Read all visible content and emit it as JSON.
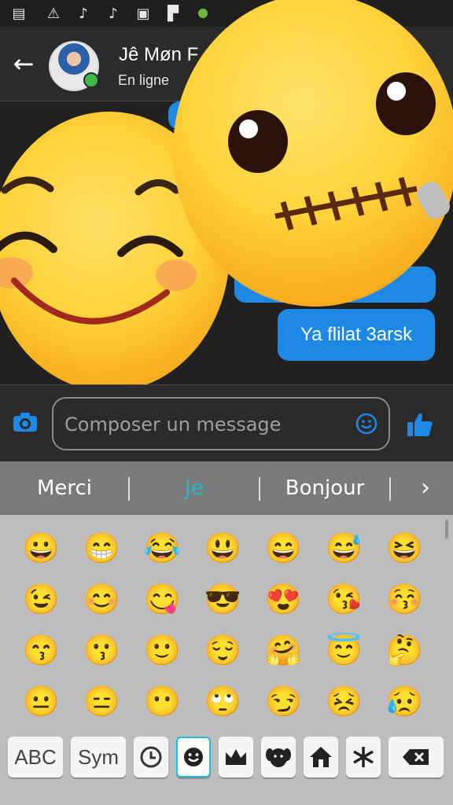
{
  "status_bar": {
    "icons": [
      "message-icon",
      "warning-icon",
      "tiktok-icon",
      "tiktok-icon",
      "image-icon",
      "flipboard-icon"
    ]
  },
  "header": {
    "back_icon": "back-arrow-icon",
    "contact_name": "Jê Møn F",
    "status": "En ligne"
  },
  "chat": {
    "messages": [
      {
        "text": "Ya flilat 3arsk",
        "from": "me"
      }
    ],
    "overlays": [
      "smiling-face-emoji",
      "zipper-mouth-face-emoji"
    ]
  },
  "composer": {
    "placeholder": "Composer un message",
    "camera_icon": "camera-icon",
    "emoji_icon": "smiley-icon",
    "like_icon": "thumbs-up-icon"
  },
  "suggestions": {
    "items": [
      "Merci",
      "Je",
      "Bonjour"
    ],
    "highlighted": "Je",
    "more_icon": "chevron-right-icon"
  },
  "keyboard": {
    "emojis": [
      [
        "😀",
        "😁",
        "😂",
        "😃",
        "😄",
        "😅",
        "😆"
      ],
      [
        "😉",
        "😊",
        "😋",
        "😎",
        "😍",
        "😘",
        "😚"
      ],
      [
        "😙",
        "😗",
        "🙂",
        "😌",
        "🤗",
        "😇",
        "🤔"
      ],
      [
        "😐",
        "😑",
        "😶",
        "🙄",
        "😏",
        "😣",
        "😥"
      ]
    ],
    "bottom_keys": {
      "abc": "ABC",
      "sym": "Sym",
      "icons": [
        "recent-clock-icon",
        "smiley-icon",
        "crown-icon",
        "dog-icon",
        "house-icon",
        "asterisk-icon",
        "backspace-icon"
      ]
    }
  },
  "colors": {
    "accent": "#1e88e5",
    "highlight": "#27b7d6",
    "online": "#3fba4a"
  }
}
